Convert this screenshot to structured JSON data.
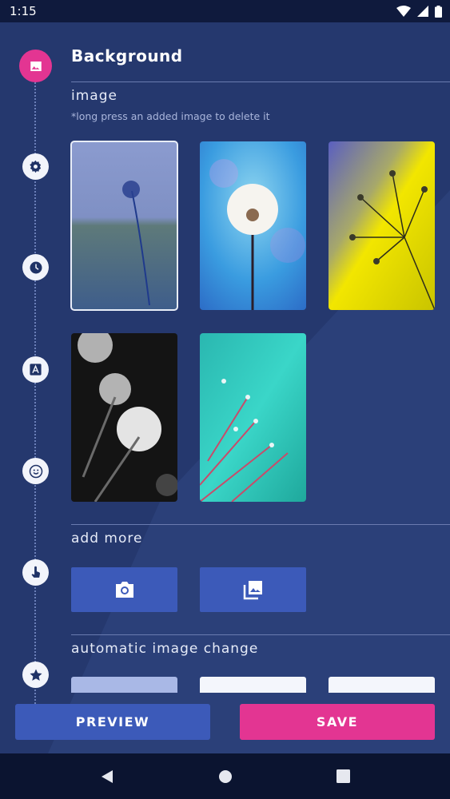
{
  "status_bar": {
    "time": "1:15"
  },
  "header": {
    "title": "Background"
  },
  "image_section": {
    "title": "image",
    "hint": "*long press an added image to delete it",
    "images": [
      {
        "name": "dandelion-field",
        "selected": true
      },
      {
        "name": "dandelion-blue-sparkle",
        "selected": false
      },
      {
        "name": "dandelion-yellow-drops",
        "selected": false
      },
      {
        "name": "dandelion-black-white",
        "selected": false
      },
      {
        "name": "dandelion-teal-drops",
        "selected": false
      }
    ]
  },
  "add_more": {
    "title": "add more",
    "camera_icon": "camera-icon",
    "gallery_icon": "gallery-icon"
  },
  "auto_change": {
    "title": "automatic image change"
  },
  "buttons": {
    "preview": "PREVIEW",
    "save": "SAVE"
  },
  "rail": {
    "items": [
      "image-icon",
      "gear-icon",
      "clock-icon",
      "font-icon",
      "smiley-icon",
      "touch-icon",
      "star-icon"
    ]
  },
  "colors": {
    "accent": "#e33592",
    "primary_button": "#3c5ab9",
    "background": "#25386e"
  }
}
